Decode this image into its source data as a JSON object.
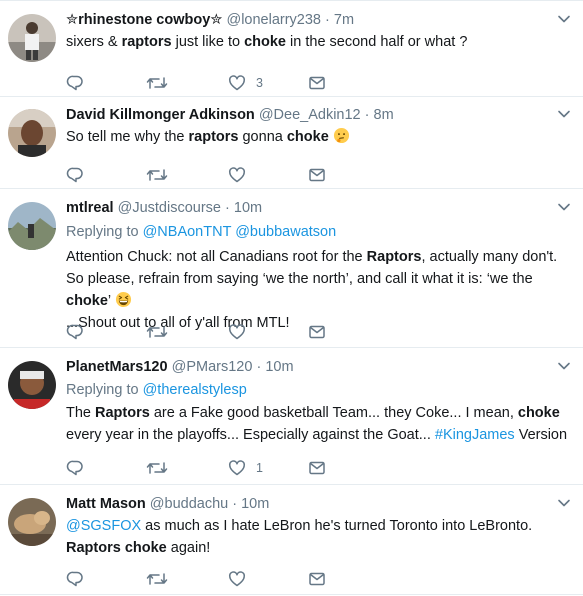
{
  "colors": {
    "link": "#1b95e0",
    "secondary": "#657786",
    "text": "#14171a",
    "divider": "#e6ecf0"
  },
  "tweets": [
    {
      "name": "✮rhinestone cowboy✮",
      "handle": "@lonelarry238",
      "dot": "·",
      "time": "7m",
      "text_parts": [
        "sixers & ",
        "raptors",
        " just like to ",
        "choke",
        " in the second half or what ?"
      ],
      "likes": "3"
    },
    {
      "name": "David Killmonger Adkinson",
      "handle": "@Dee_Adkin12",
      "dot": "·",
      "time": "8m",
      "text_parts": [
        "So tell me why the ",
        "raptors",
        " gonna ",
        "choke"
      ],
      "emoji": "thinking-face"
    },
    {
      "name": "mtlreal",
      "handle": "@Justdiscourse",
      "dot": "·",
      "time": "10m",
      "replying_label": "Replying to",
      "replying_mentions": [
        "@NBAonTNT",
        "@bubbawatson"
      ],
      "text_parts": [
        "Attention Chuck: not all Canadians root for the ",
        "Raptors",
        ", actually many don't. So please, refrain from saying ‘we the north’, and call it what it is: ‘we the ",
        "choke",
        "’"
      ],
      "text_tail": "...Shout out to all of y'all from MTL!",
      "emoji": "grinning-squinting-face"
    },
    {
      "name": "PlanetMars120",
      "handle": "@PMars120",
      "dot": "·",
      "time": "10m",
      "replying_label": "Replying to",
      "replying_mentions": [
        "@therealstylesp"
      ],
      "text_parts": [
        "The ",
        "Raptors",
        " are a Fake good basketball Team... they Coke... I mean, ",
        "choke",
        " every year in the playoffs... Especially against the Goat... ",
        "#KingJames",
        " Version"
      ],
      "likes": "1"
    },
    {
      "name": "Matt Mason",
      "handle": "@buddachu",
      "dot": "·",
      "time": "10m",
      "text_parts": [
        "@SGSFOX",
        " as much as I hate LeBron he's turned Toronto into LeBronto. ",
        "Raptors",
        " ",
        "choke",
        " again!"
      ]
    }
  ],
  "action_icons": [
    "reply-icon",
    "retweet-icon",
    "like-icon",
    "message-icon"
  ]
}
